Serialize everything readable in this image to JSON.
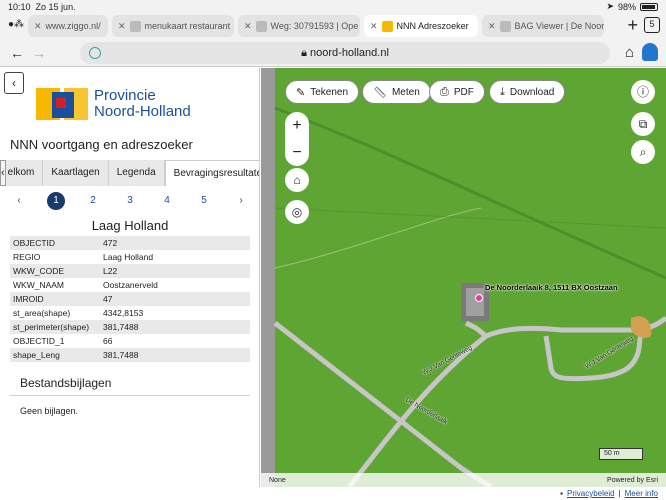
{
  "status": {
    "time": "10:10",
    "date": "Zo 15 jun.",
    "battery": "98%"
  },
  "browser_tabs": [
    {
      "label": "www.ziggo.nl/"
    },
    {
      "label": "menukaart restaurant"
    },
    {
      "label": "Weg: 30791593 | Ope"
    },
    {
      "label": "NNN Adreszoeker",
      "active": true
    },
    {
      "label": "BAG Viewer | De Noor"
    }
  ],
  "tab_count": "5",
  "url": "noord-holland.nl",
  "sidebar": {
    "logo_line1": "Provincie",
    "logo_line2": "Noord-Holland",
    "app_title": "NNN voortgang en adreszoeker",
    "tabs": [
      "elkom",
      "Kaartlagen",
      "Legenda",
      "Bevragingsresultaten"
    ],
    "pages": [
      "1",
      "2",
      "3",
      "4",
      "5"
    ],
    "feature_title": "Laag Holland",
    "attributes": [
      {
        "key": "OBJECTID",
        "value": "472"
      },
      {
        "key": "REGIO",
        "value": "Laag Holland"
      },
      {
        "key": "WKW_CODE",
        "value": "L22"
      },
      {
        "key": "WKW_NAAM",
        "value": "Oostzanerveld"
      },
      {
        "key": "IMROID",
        "value": "47"
      },
      {
        "key": "st_area(shape)",
        "value": "4342,8153"
      },
      {
        "key": "st_perimeter(shape)",
        "value": "381,7488"
      },
      {
        "key": "OBJECTID_1",
        "value": "66"
      },
      {
        "key": "shape_Leng",
        "value": "381,7488"
      }
    ],
    "section_title": "Bestandsbijlagen",
    "no_files": "Geen bijlagen."
  },
  "map": {
    "tools": [
      "Tekenen",
      "Meten",
      "PDF",
      "Download"
    ],
    "address_label": "De Noorderlaaik 8, 1511 BX Oostzaan",
    "road_labels": [
      "W.J.Van Genteweg",
      "De Noorderlaaik",
      "W.J.Van Genteweg"
    ],
    "scale": "50 m",
    "footer_left": "None",
    "footer_right": "Powered by Esri"
  },
  "footer": {
    "privacy": "Privacybeleid",
    "more": "Meer info"
  }
}
